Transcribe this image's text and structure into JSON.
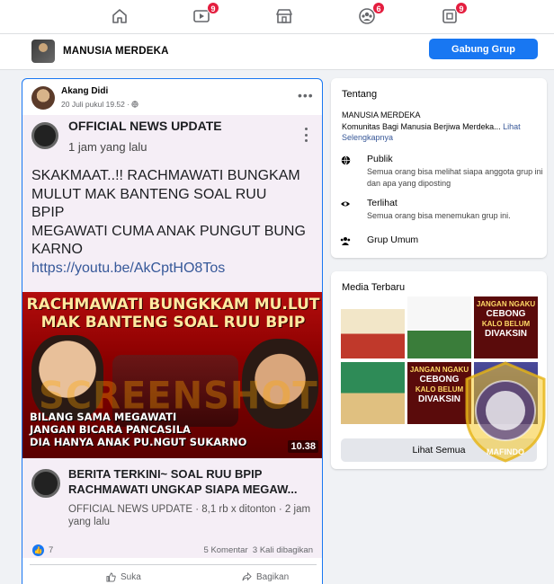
{
  "topnav": {
    "items": [
      {
        "icon": "home-icon",
        "badge": ""
      },
      {
        "icon": "watch-icon",
        "badge": "9"
      },
      {
        "icon": "marketplace-icon",
        "badge": ""
      },
      {
        "icon": "groups-icon",
        "badge": "6"
      },
      {
        "icon": "gaming-icon",
        "badge": "9"
      }
    ]
  },
  "group": {
    "name": "MANUSIA MERDEKA",
    "join_label": "Gabung Grup",
    "accent": "#1877f2"
  },
  "post": {
    "author": "Akang Didi",
    "meta": "20 Juli pukul 19.52 · ",
    "shared": {
      "source": "OFFICIAL NEWS UPDATE",
      "time": "1 jam yang lalu",
      "lines": [
        "SKAKMAAT..!! RACHMAWATI BUNGKAM",
        "MULUT MAK BANTENG SOAL RUU",
        "BPIP",
        "MEGAWATI CUMA ANAK PUNGUT BUNG",
        "KARNO"
      ],
      "link": "https://youtu.be/AkCptHO8Tos",
      "thumbnail": {
        "headline_1": "RACHMAWATI BUNGKKAM MU.LUT",
        "headline_2": "MAK BANTENG SOAL RUU BPIP",
        "caption_1": "BILANG SAMA MEGAWATI",
        "caption_2": "JANGAN BICARA PANCASILA",
        "caption_3": "DIA HANYA ANAK PU.NGUT SUKARNO",
        "duration": "10.38"
      },
      "watermark": "SCREENSHOT",
      "card_title": "BERITA TERKINI~ SOAL RUU BPIP RACHMAWATI UNGKAP SIAPA MEGAW...",
      "card_meta": "OFFICIAL NEWS UPDATE · 8,1 rb x ditonton · 2 jam yang lalu"
    },
    "likes": "7",
    "comments": "5 Komentar",
    "shares": "3 Kali dibagikan",
    "like_label": "Suka",
    "share_label": "Bagikan"
  },
  "about": {
    "title": "Tentang",
    "desc_1": "MANUSIA MERDEKA",
    "desc_2": "Komunitas Bagi Manusia Berjiwa Merdeka...",
    "see_more": "Lihat Selengkapnya",
    "public_title": "Publik",
    "public_sub": "Semua orang bisa melihat siapa anggota grup ini dan apa yang diposting",
    "visible_title": "Terlihat",
    "visible_sub": "Semua orang bisa menemukan grup ini.",
    "type": "Grup Umum"
  },
  "media": {
    "title": "Media Terbaru",
    "see_all": "Lihat Semua",
    "tile_texts": [
      "JANGAN NGAKU",
      "CEBONG",
      "KALO BELUM",
      "DIVAKSIN",
      "JANGAN NGAKU",
      "CEBONG",
      "KALO BELUM",
      "DIVAKSIN"
    ]
  },
  "seal": {
    "text": "MAFINDO"
  }
}
